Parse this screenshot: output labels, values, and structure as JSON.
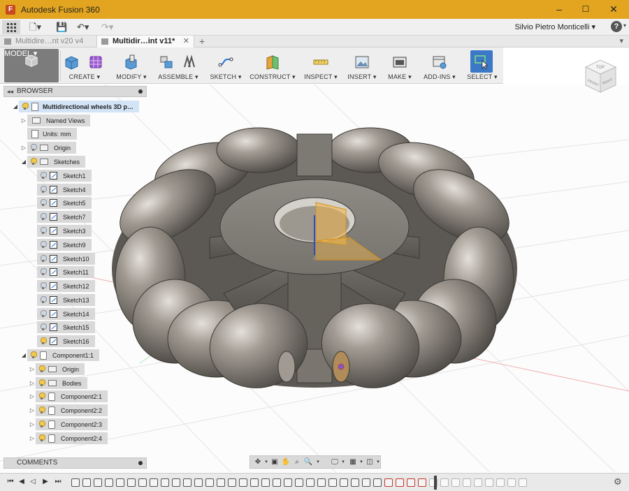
{
  "window": {
    "title": "Autodesk Fusion 360",
    "minimize": "–",
    "maximize": "☐",
    "close": "✕"
  },
  "quickbar": {
    "user": "Silvio Pietro Monticelli",
    "help": "?"
  },
  "tabs": [
    {
      "label": "Multidire…nt v20 v4",
      "active": false
    },
    {
      "label": "Multidir…int v11*",
      "active": true
    }
  ],
  "toolbar": {
    "workspace": "MODEL ▾",
    "groups": [
      {
        "label": "CREATE ▾",
        "icon": "box-icon"
      },
      {
        "label": "MODIFY ▾",
        "icon": "press-pull-icon"
      },
      {
        "label": "ASSEMBLE ▾",
        "icon": "component-icon"
      },
      {
        "label": "SKETCH ▾",
        "icon": "sketch-curve-icon"
      },
      {
        "label": "CONSTRUCT ▾",
        "icon": "plane-icon"
      },
      {
        "label": "INSPECT ▾",
        "icon": "measure-icon"
      },
      {
        "label": "INSERT ▾",
        "icon": "image-icon"
      },
      {
        "label": "MAKE ▾",
        "icon": "printer-icon"
      },
      {
        "label": "ADD-INS ▾",
        "icon": "addins-icon"
      },
      {
        "label": "SELECT ▾",
        "icon": "select-arrow-icon"
      }
    ]
  },
  "browser": {
    "header": "BROWSER",
    "root": "Multidirectional wheels 3D p…",
    "named_views": "Named Views",
    "units": "Units: mm",
    "origin": "Origin",
    "sketches_folder": "Sketches",
    "sketches": [
      "Sketch1",
      "Sketch4",
      "Sketch5",
      "Sketch7",
      "Sketch3",
      "Sketch9",
      "Sketch10",
      "Sketch11",
      "Sketch12",
      "Sketch13",
      "Sketch14",
      "Sketch15",
      "Sketch16"
    ],
    "component": "Component1:1",
    "component_children": [
      "Origin",
      "Bodies",
      "Component2:1",
      "Component2:2",
      "Component2:3",
      "Component2:4"
    ]
  },
  "comments": {
    "header": "COMMENTS"
  },
  "viewcube": {
    "top": "TOP",
    "front": "FRONT",
    "right": "RIGHT"
  },
  "colors": {
    "title_bar": "#e3a520",
    "selection": "#d4e4f7",
    "model_metal": "#8a857e",
    "select_accent": "#3c78c8"
  }
}
